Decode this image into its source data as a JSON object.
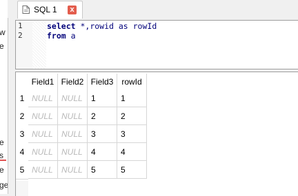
{
  "tab": {
    "label": "SQL 1",
    "close_symbol": "x",
    "icon": "sql-file-icon",
    "accent": "#e35d4d"
  },
  "editor": {
    "line_numbers": [
      "1",
      "2"
    ],
    "lines": [
      {
        "kw": "select",
        "rest": " *,rowid as rowId"
      },
      {
        "kw": "from",
        "rest": " a"
      }
    ]
  },
  "grid": {
    "columns": [
      "Field1",
      "Field2",
      "Field3",
      "rowId"
    ],
    "rows": [
      {
        "num": "1",
        "cells": [
          "NULL",
          "NULL",
          "1",
          "1"
        ]
      },
      {
        "num": "2",
        "cells": [
          "NULL",
          "NULL",
          "2",
          "2"
        ]
      },
      {
        "num": "3",
        "cells": [
          "NULL",
          "NULL",
          "3",
          "3"
        ]
      },
      {
        "num": "4",
        "cells": [
          "NULL",
          "NULL",
          "4",
          "4"
        ]
      },
      {
        "num": "5",
        "cells": [
          "NULL",
          "NULL",
          "5",
          "5"
        ]
      }
    ]
  },
  "left_strip": {
    "chars": [
      "w",
      "e",
      "e",
      "s",
      "e",
      "ge"
    ]
  }
}
